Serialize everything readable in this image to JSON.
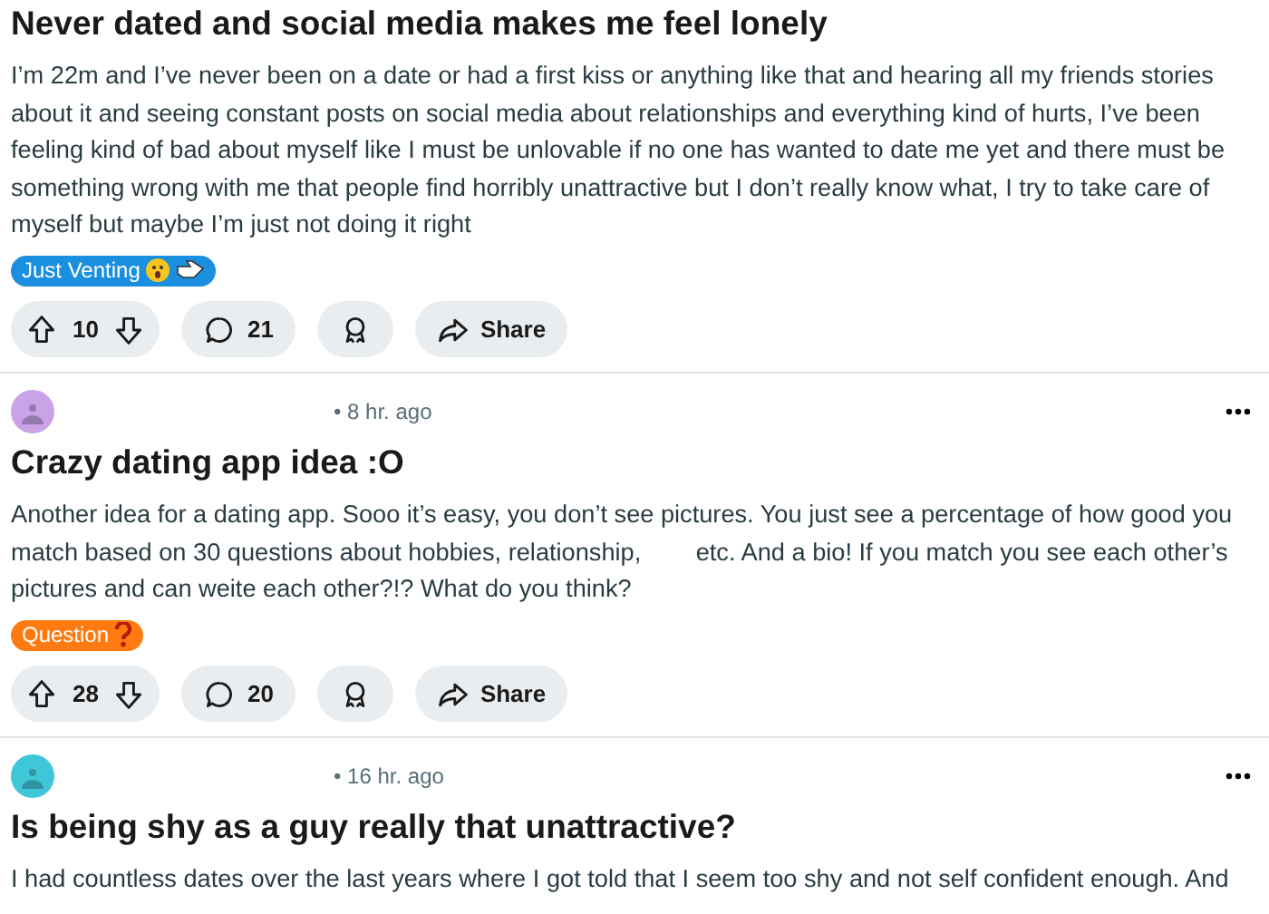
{
  "posts": [
    {
      "title": "Never dated and social media makes me feel lonely",
      "body": "I’m 22m and I’ve never been on a date or had a first kiss or anything like that and hearing all my friends stories about it and seeing constant posts on social media about relationships and everything kind of hurts, I’ve been feeling kind of bad about myself like I must be unlovable if no one has wanted to date me yet and there must be something wrong with me that people find horribly unattractive but I don’t really know what, I try to take care of myself but maybe I’m just not doing it right",
      "flair": {
        "label": "Just Venting",
        "color": "#1a8fe0",
        "kind": "venting"
      },
      "votes": "10",
      "comments": "21",
      "share": "Share"
    },
    {
      "time": "• 8 hr. ago",
      "avatar": {
        "color": "#c9a2e8"
      },
      "title": "Crazy dating app idea :O",
      "body": "Another idea for a dating app. Sooo it’s easy, you don’t see pictures. You just see a percentage of how good you match based on 30 questions about hobbies, relationship,        etc. And a bio! If you match you see each other’s pictures and can weite each other?!? What do you think?",
      "flair": {
        "label": "Question",
        "color": "#ff7a10",
        "kind": "question"
      },
      "votes": "28",
      "comments": "20",
      "share": "Share"
    },
    {
      "time": "• 16 hr. ago",
      "avatar": {
        "color": "#3fc7d8"
      },
      "title": "Is being shy as a guy really that unattractive?",
      "body": "I had countless dates over the last years where I got told that I seem too shy and not self confident enough. And"
    }
  ]
}
